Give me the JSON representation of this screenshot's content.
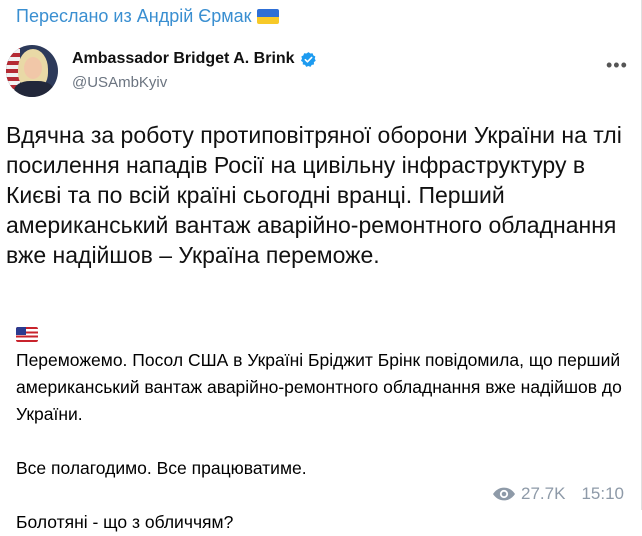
{
  "forward": {
    "label": "Переслано из Андрій Єрмак",
    "flag_icon": "ukraine-flag"
  },
  "tweet": {
    "author_name": "Ambassador Bridget A. Brink",
    "handle": "@USAmbKyiv",
    "verified_icon": "verified-badge",
    "more_icon": "more-dots",
    "text": "Вдячна за роботу протиповітряної оборони України на тлі посилення нападів Росії на цивільну інфраструктуру в Києві та по всій країні сьогодні вранці. Перший американський вантаж аварійно-ремонтного обладнання вже надійшов – Україна переможе."
  },
  "message": {
    "line1": "Переможемо. Посол США в Україні Бріджит Брінк повідомила, що перший американський вантаж аварійно-ремонтного обладнання вже надійшов до України.",
    "line2": "Все полагодимо. Все працюватиме.",
    "line3": "Болотяні - що з обличчям?"
  },
  "meta": {
    "views": "27.7K",
    "time": "15:10",
    "views_icon": "eye-icon"
  },
  "colors": {
    "link_blue": "#3a8fd1",
    "meta_gray": "#8e9aa8",
    "verified_blue": "#1d9bf0"
  }
}
